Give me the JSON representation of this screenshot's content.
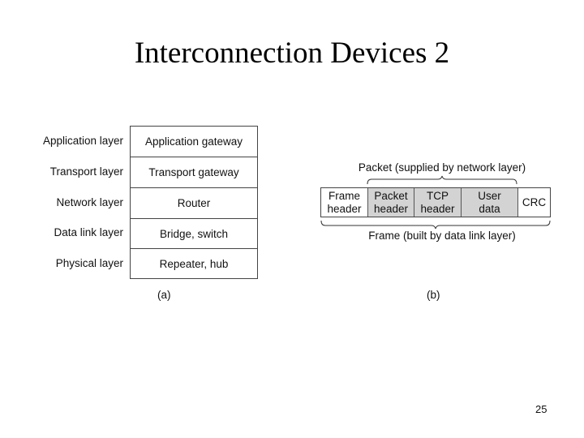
{
  "slide": {
    "title": "Interconnection Devices 2",
    "page_number": "25"
  },
  "figure_a": {
    "caption": "(a)",
    "rows": [
      {
        "layer": "Application layer",
        "device": "Application gateway"
      },
      {
        "layer": "Transport layer",
        "device": "Transport gateway"
      },
      {
        "layer": "Network layer",
        "device": "Router"
      },
      {
        "layer": "Data link layer",
        "device": "Bridge, switch"
      },
      {
        "layer": "Physical layer",
        "device": "Repeater, hub"
      }
    ]
  },
  "figure_b": {
    "caption": "(b)",
    "packet_label": "Packet (supplied by network layer)",
    "frame_label": "Frame (built by data link layer)",
    "cells": [
      {
        "label": "Frame\nheader",
        "shaded": false
      },
      {
        "label": "Packet\nheader",
        "shaded": true
      },
      {
        "label": "TCP\nheader",
        "shaded": true
      },
      {
        "label": "User\ndata",
        "shaded": true
      },
      {
        "label": "CRC",
        "shaded": false
      }
    ],
    "colors": {
      "shaded_fill": "#d3d3d3",
      "border": "#444444"
    }
  }
}
